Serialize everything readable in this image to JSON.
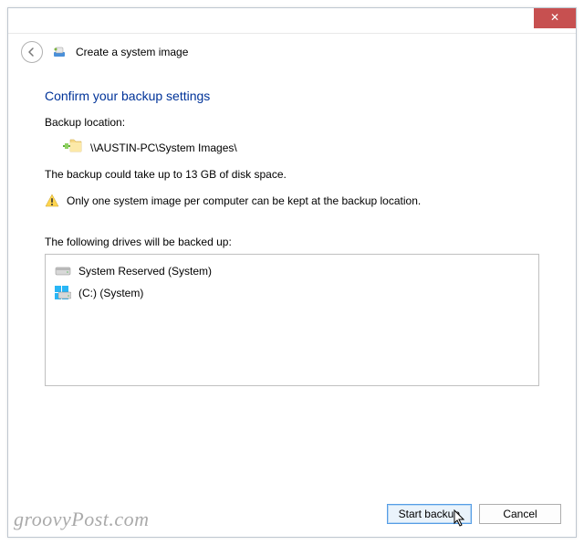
{
  "window": {
    "title": "Create a system image",
    "close_glyph": "✕"
  },
  "main": {
    "heading": "Confirm your backup settings",
    "backup_location_label": "Backup location:",
    "backup_location_path": "\\\\AUSTIN-PC\\System Images\\",
    "space_info": "The backup could take up to 13 GB of disk space.",
    "warning_text": "Only one system image per computer can be kept at the backup location.",
    "drives_label": "The following drives will be backed up:",
    "drives": [
      {
        "label": "System Reserved (System)"
      },
      {
        "label": "(C:) (System)"
      }
    ]
  },
  "buttons": {
    "start": "Start backup",
    "cancel": "Cancel"
  },
  "watermark": "groovyPost.com"
}
